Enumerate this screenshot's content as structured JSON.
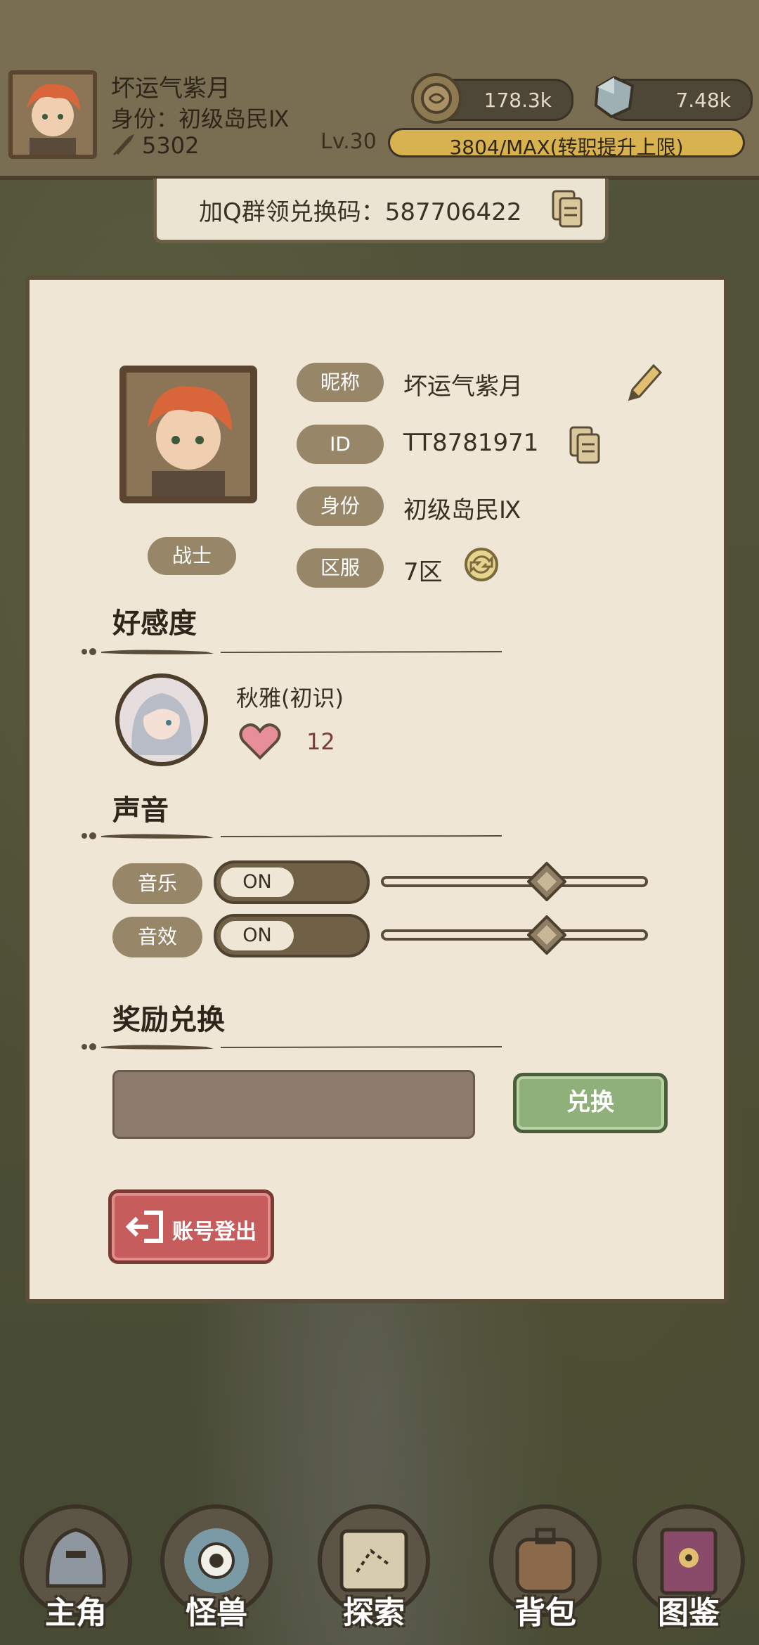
{
  "top_bar": {
    "name": "坏运气紫月",
    "identity": "身份：初级岛民Ⅸ",
    "power": "5302",
    "gold": "178.3k",
    "gems": "7.48k",
    "level": "Lv.30",
    "xp_text": "3804/MAX(转职提升上限)",
    "xp_fraction": 1.0
  },
  "code_banner": {
    "text": "加Q群领兑换码：587706422"
  },
  "profile": {
    "nickname_label": "昵称",
    "nickname": "坏运气紫月",
    "id_label": "ID",
    "id": "TT8781971",
    "identity_label": "身份",
    "identity": "初级岛民Ⅸ",
    "server_label": "区服",
    "server": "7区",
    "class": "战士"
  },
  "favor": {
    "title": "好感度",
    "npc_name": "秋雅(初识)",
    "value": "12"
  },
  "sound": {
    "title": "声音",
    "music_label": "音乐",
    "music_state": "ON",
    "music_level": 0.62,
    "sfx_label": "音效",
    "sfx_state": "ON",
    "sfx_level": 0.62
  },
  "reward": {
    "title": "奖励兑换",
    "input_value": "",
    "button_label": "兑换"
  },
  "logout": {
    "label": "账号登出"
  },
  "nav": {
    "items": [
      {
        "label": "主角"
      },
      {
        "label": "怪兽"
      },
      {
        "label": "探索"
      },
      {
        "label": "背包"
      },
      {
        "label": "图鉴"
      }
    ]
  },
  "colors": {
    "panel": "#f0e6d6",
    "accent_green": "#8fb07a",
    "accent_red": "#c65c5c",
    "pill": "#978768"
  }
}
